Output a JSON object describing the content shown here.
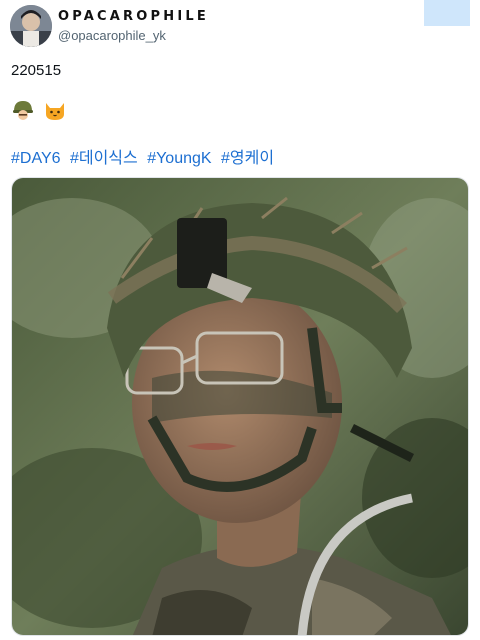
{
  "account": {
    "display_name": "OPACAROPHILE",
    "handle": "@opacarophile_yk"
  },
  "tweet": {
    "text": "220515",
    "emojis": [
      "helmet-emoji",
      "cat-emoji"
    ],
    "hashtags": [
      "#DAY6",
      "#데이식스",
      "#YoungK",
      "#영케이"
    ]
  },
  "media": {
    "icon": "photo-soldier-portrait"
  },
  "colors": {
    "link": "#1d6fd1",
    "handle": "#536471",
    "corner_button": "#cfe6fb"
  }
}
